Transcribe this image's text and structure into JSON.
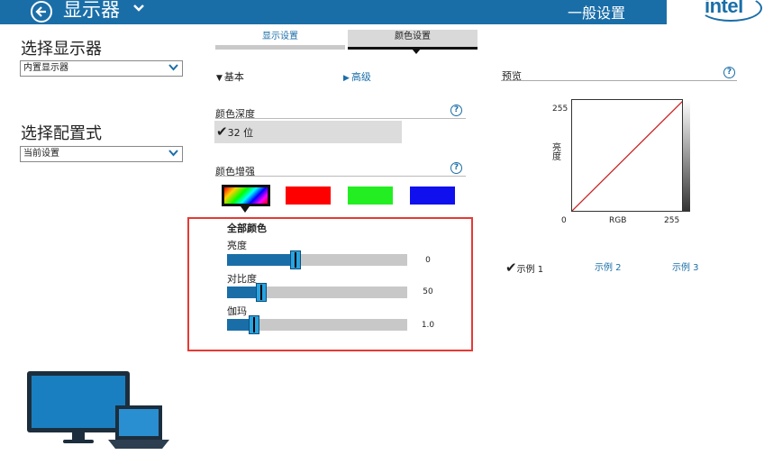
{
  "header": {
    "title": "显示器",
    "right_title": "一般设置",
    "logo_text": "intel"
  },
  "sidebar": {
    "display_section_label": "选择显示器",
    "display_value": "内置显示器",
    "profile_section_label": "选择配置式",
    "profile_value": "当前设置"
  },
  "tabs": [
    {
      "label": "显示设置",
      "active": false
    },
    {
      "label": "颜色设置",
      "active": true
    }
  ],
  "modes": {
    "basic_label": "基本",
    "advanced_label": "高级"
  },
  "color_depth": {
    "label": "颜色深度",
    "value": "32 位",
    "help": "?"
  },
  "color_enhance": {
    "label": "颜色增强",
    "help": "?",
    "swatches": [
      "all-colors",
      "red",
      "green",
      "blue"
    ],
    "swatch_colors": {
      "red": "#ff0000",
      "green": "#22ee22",
      "blue": "#1010ee"
    }
  },
  "controls": {
    "group_title": "全部颜色",
    "brightness": {
      "label": "亮度",
      "value": "0",
      "level": 0.38
    },
    "contrast": {
      "label": "对比度",
      "value": "50",
      "level": 0.19
    },
    "gamma": {
      "label": "伽玛",
      "value": "1.0",
      "level": 0.15
    }
  },
  "preview": {
    "label": "预览",
    "help": "?",
    "y_axis": "亮度",
    "y_max": "255",
    "x_min": "0",
    "x_label": "RGB",
    "x_max": "255"
  },
  "examples": [
    {
      "label": "示例 1",
      "active": true
    },
    {
      "label": "示例 2",
      "active": false
    },
    {
      "label": "示例 3",
      "active": false
    }
  ],
  "colors": {
    "accent": "#1a6ea8",
    "highlight": "#e53935"
  }
}
